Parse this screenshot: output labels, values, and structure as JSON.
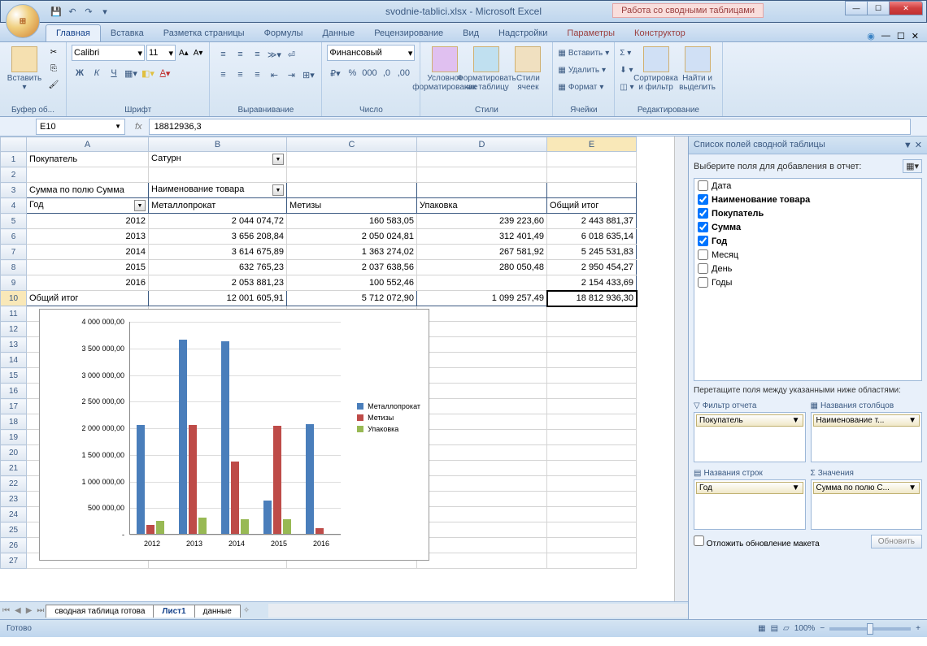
{
  "title": "svodnie-tablici.xlsx - Microsoft Excel",
  "context_title": "Работа со сводными таблицами",
  "tabs": [
    "Главная",
    "Вставка",
    "Разметка страницы",
    "Формулы",
    "Данные",
    "Рецензирование",
    "Вид",
    "Надстройки"
  ],
  "context_tabs": [
    "Параметры",
    "Конструктор"
  ],
  "ribbon": {
    "clipboard": {
      "paste": "Вставить",
      "label": "Буфер об..."
    },
    "font": {
      "name": "Calibri",
      "size": "11",
      "label": "Шрифт"
    },
    "align": {
      "label": "Выравнивание"
    },
    "number": {
      "format": "Финансовый",
      "label": "Число"
    },
    "styles": {
      "cond": "Условное форматирование",
      "table": "Форматировать как таблицу",
      "cell": "Стили ячеек",
      "label": "Стили"
    },
    "cells": {
      "insert": "Вставить",
      "delete": "Удалить",
      "format": "Формат",
      "label": "Ячейки"
    },
    "edit": {
      "sort": "Сортировка и фильтр",
      "find": "Найти и выделить",
      "label": "Редактирование"
    }
  },
  "namebox": "E10",
  "formula": "18812936,3",
  "columns": [
    "A",
    "B",
    "C",
    "D",
    "E"
  ],
  "rownums": [
    1,
    2,
    3,
    4,
    5,
    6,
    7,
    8,
    9,
    10,
    11,
    12,
    13,
    14,
    15,
    16,
    17,
    18,
    19,
    20,
    21,
    22,
    23,
    24,
    25,
    26,
    27
  ],
  "pivot": {
    "buyer_label": "Покупатель",
    "buyer_value": "Сатурн",
    "sum_label": "Сумма по полю Сумма",
    "name_label": "Наименование товара",
    "year_label": "Год",
    "col_headers": [
      "Металлопрокат",
      "Метизы",
      "Упаковка",
      "Общий итог"
    ],
    "rows": [
      {
        "year": "2012",
        "v": [
          "2 044 074,72",
          "160 583,05",
          "239 223,60",
          "2 443 881,37"
        ]
      },
      {
        "year": "2013",
        "v": [
          "3 656 208,84",
          "2 050 024,81",
          "312 401,49",
          "6 018 635,14"
        ]
      },
      {
        "year": "2014",
        "v": [
          "3 614 675,89",
          "1 363 274,02",
          "267 581,92",
          "5 245 531,83"
        ]
      },
      {
        "year": "2015",
        "v": [
          "632 765,23",
          "2 037 638,56",
          "280 050,48",
          "2 950 454,27"
        ]
      },
      {
        "year": "2016",
        "v": [
          "2 053 881,23",
          "100 552,46",
          "",
          "2 154 433,69"
        ]
      }
    ],
    "total_label": "Общий итог",
    "totals": [
      "12 001 605,91",
      "5 712 072,90",
      "1 099 257,49",
      "18 812 936,30"
    ]
  },
  "chart_data": {
    "type": "bar",
    "categories": [
      "2012",
      "2013",
      "2014",
      "2015",
      "2016"
    ],
    "series": [
      {
        "name": "Металлопрокат",
        "color": "#4a7ebb",
        "values": [
          2044074.72,
          3656208.84,
          3614675.89,
          632765.23,
          2053881.23
        ]
      },
      {
        "name": "Метизы",
        "color": "#be4b48",
        "values": [
          160583.05,
          2050024.81,
          1363274.02,
          2037638.56,
          100552.46
        ]
      },
      {
        "name": "Упаковка",
        "color": "#98b954",
        "values": [
          239223.6,
          312401.49,
          267581.92,
          280050.48,
          0
        ]
      }
    ],
    "yticks": [
      "-",
      "500 000,00",
      "1 000 000,00",
      "1 500 000,00",
      "2 000 000,00",
      "2 500 000,00",
      "3 000 000,00",
      "3 500 000,00",
      "4 000 000,00"
    ],
    "ymax": 4000000
  },
  "sheets": {
    "tabs": [
      "сводная таблица готова",
      "Лист1",
      "данные"
    ],
    "active": 1
  },
  "status": {
    "ready": "Готово",
    "zoom": "100%"
  },
  "fieldlist": {
    "title": "Список полей сводной таблицы",
    "choose": "Выберите поля для добавления в отчет:",
    "fields": [
      {
        "name": "Дата",
        "checked": false
      },
      {
        "name": "Наименование товара",
        "checked": true
      },
      {
        "name": "Покупатель",
        "checked": true
      },
      {
        "name": "Сумма",
        "checked": true
      },
      {
        "name": "Год",
        "checked": true
      },
      {
        "name": "Месяц",
        "checked": false
      },
      {
        "name": "День",
        "checked": false
      },
      {
        "name": "Годы",
        "checked": false
      }
    ],
    "drag": "Перетащите поля между указанными ниже областями:",
    "areas": {
      "filter": {
        "label": "Фильтр отчета",
        "items": [
          "Покупатель"
        ]
      },
      "cols": {
        "label": "Названия столбцов",
        "items": [
          "Наименование т..."
        ]
      },
      "rows": {
        "label": "Названия строк",
        "items": [
          "Год"
        ]
      },
      "vals": {
        "label": "Значения",
        "items": [
          "Сумма по полю С..."
        ]
      }
    },
    "defer": "Отложить обновление макета",
    "update": "Обновить"
  }
}
